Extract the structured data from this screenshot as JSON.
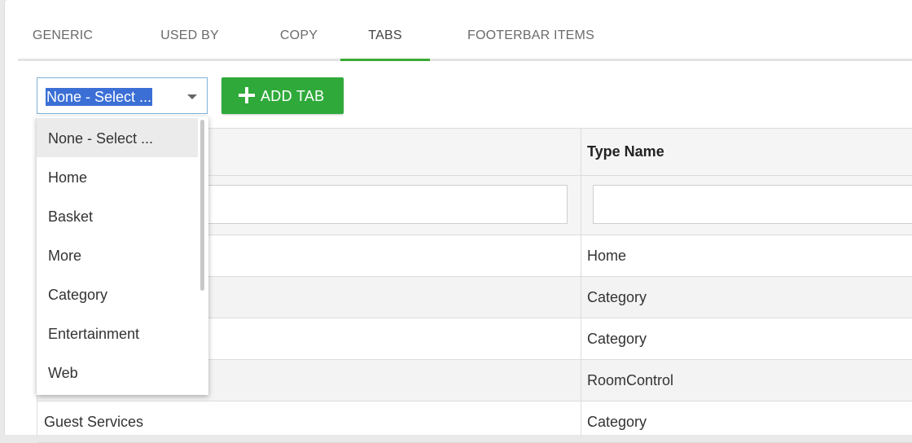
{
  "tabs": [
    {
      "label": "GENERIC"
    },
    {
      "label": "USED BY"
    },
    {
      "label": "COPY"
    },
    {
      "label": "TABS",
      "active": true
    },
    {
      "label": "FOOTERBAR ITEMS"
    }
  ],
  "toolbar": {
    "select_value": "None - Select ...",
    "add_button_label": "ADD TAB"
  },
  "dropdown": {
    "options": [
      "None - Select ...",
      "Home",
      "Basket",
      "More",
      "Category",
      "Entertainment",
      "Web"
    ]
  },
  "grid": {
    "header_type": "Type Name",
    "rows": [
      {
        "name": "",
        "type": "Home"
      },
      {
        "name": "",
        "type": "Category"
      },
      {
        "name": "",
        "type": "Category"
      },
      {
        "name": "",
        "type": "RoomControl"
      },
      {
        "name": "Guest Services",
        "type": "Category"
      }
    ]
  },
  "colors": {
    "accent": "#3aaa35",
    "button": "#2faa3a",
    "selection": "#3b6fd6"
  }
}
